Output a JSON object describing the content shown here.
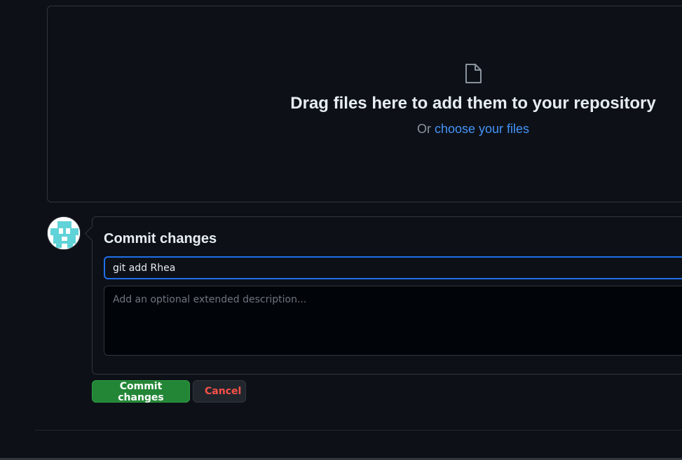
{
  "upload": {
    "icon": "file-icon",
    "title": "Drag files here to add them to your repository",
    "sub_prefix": "Or ",
    "choose_link": "choose your files"
  },
  "commit": {
    "avatar_icon": "identicon-avatar",
    "heading": "Commit changes",
    "title_value": "git add Rhea",
    "description_placeholder": "Add an optional extended description...",
    "commit_button": "Commit changes",
    "cancel_button": "Cancel"
  },
  "colors": {
    "background": "#0d1117",
    "border": "#30363d",
    "link": "#4493f8",
    "focus": "#1f6feb",
    "primary": "#238636",
    "danger": "#f85149",
    "avatar": "#5fd3d8"
  }
}
